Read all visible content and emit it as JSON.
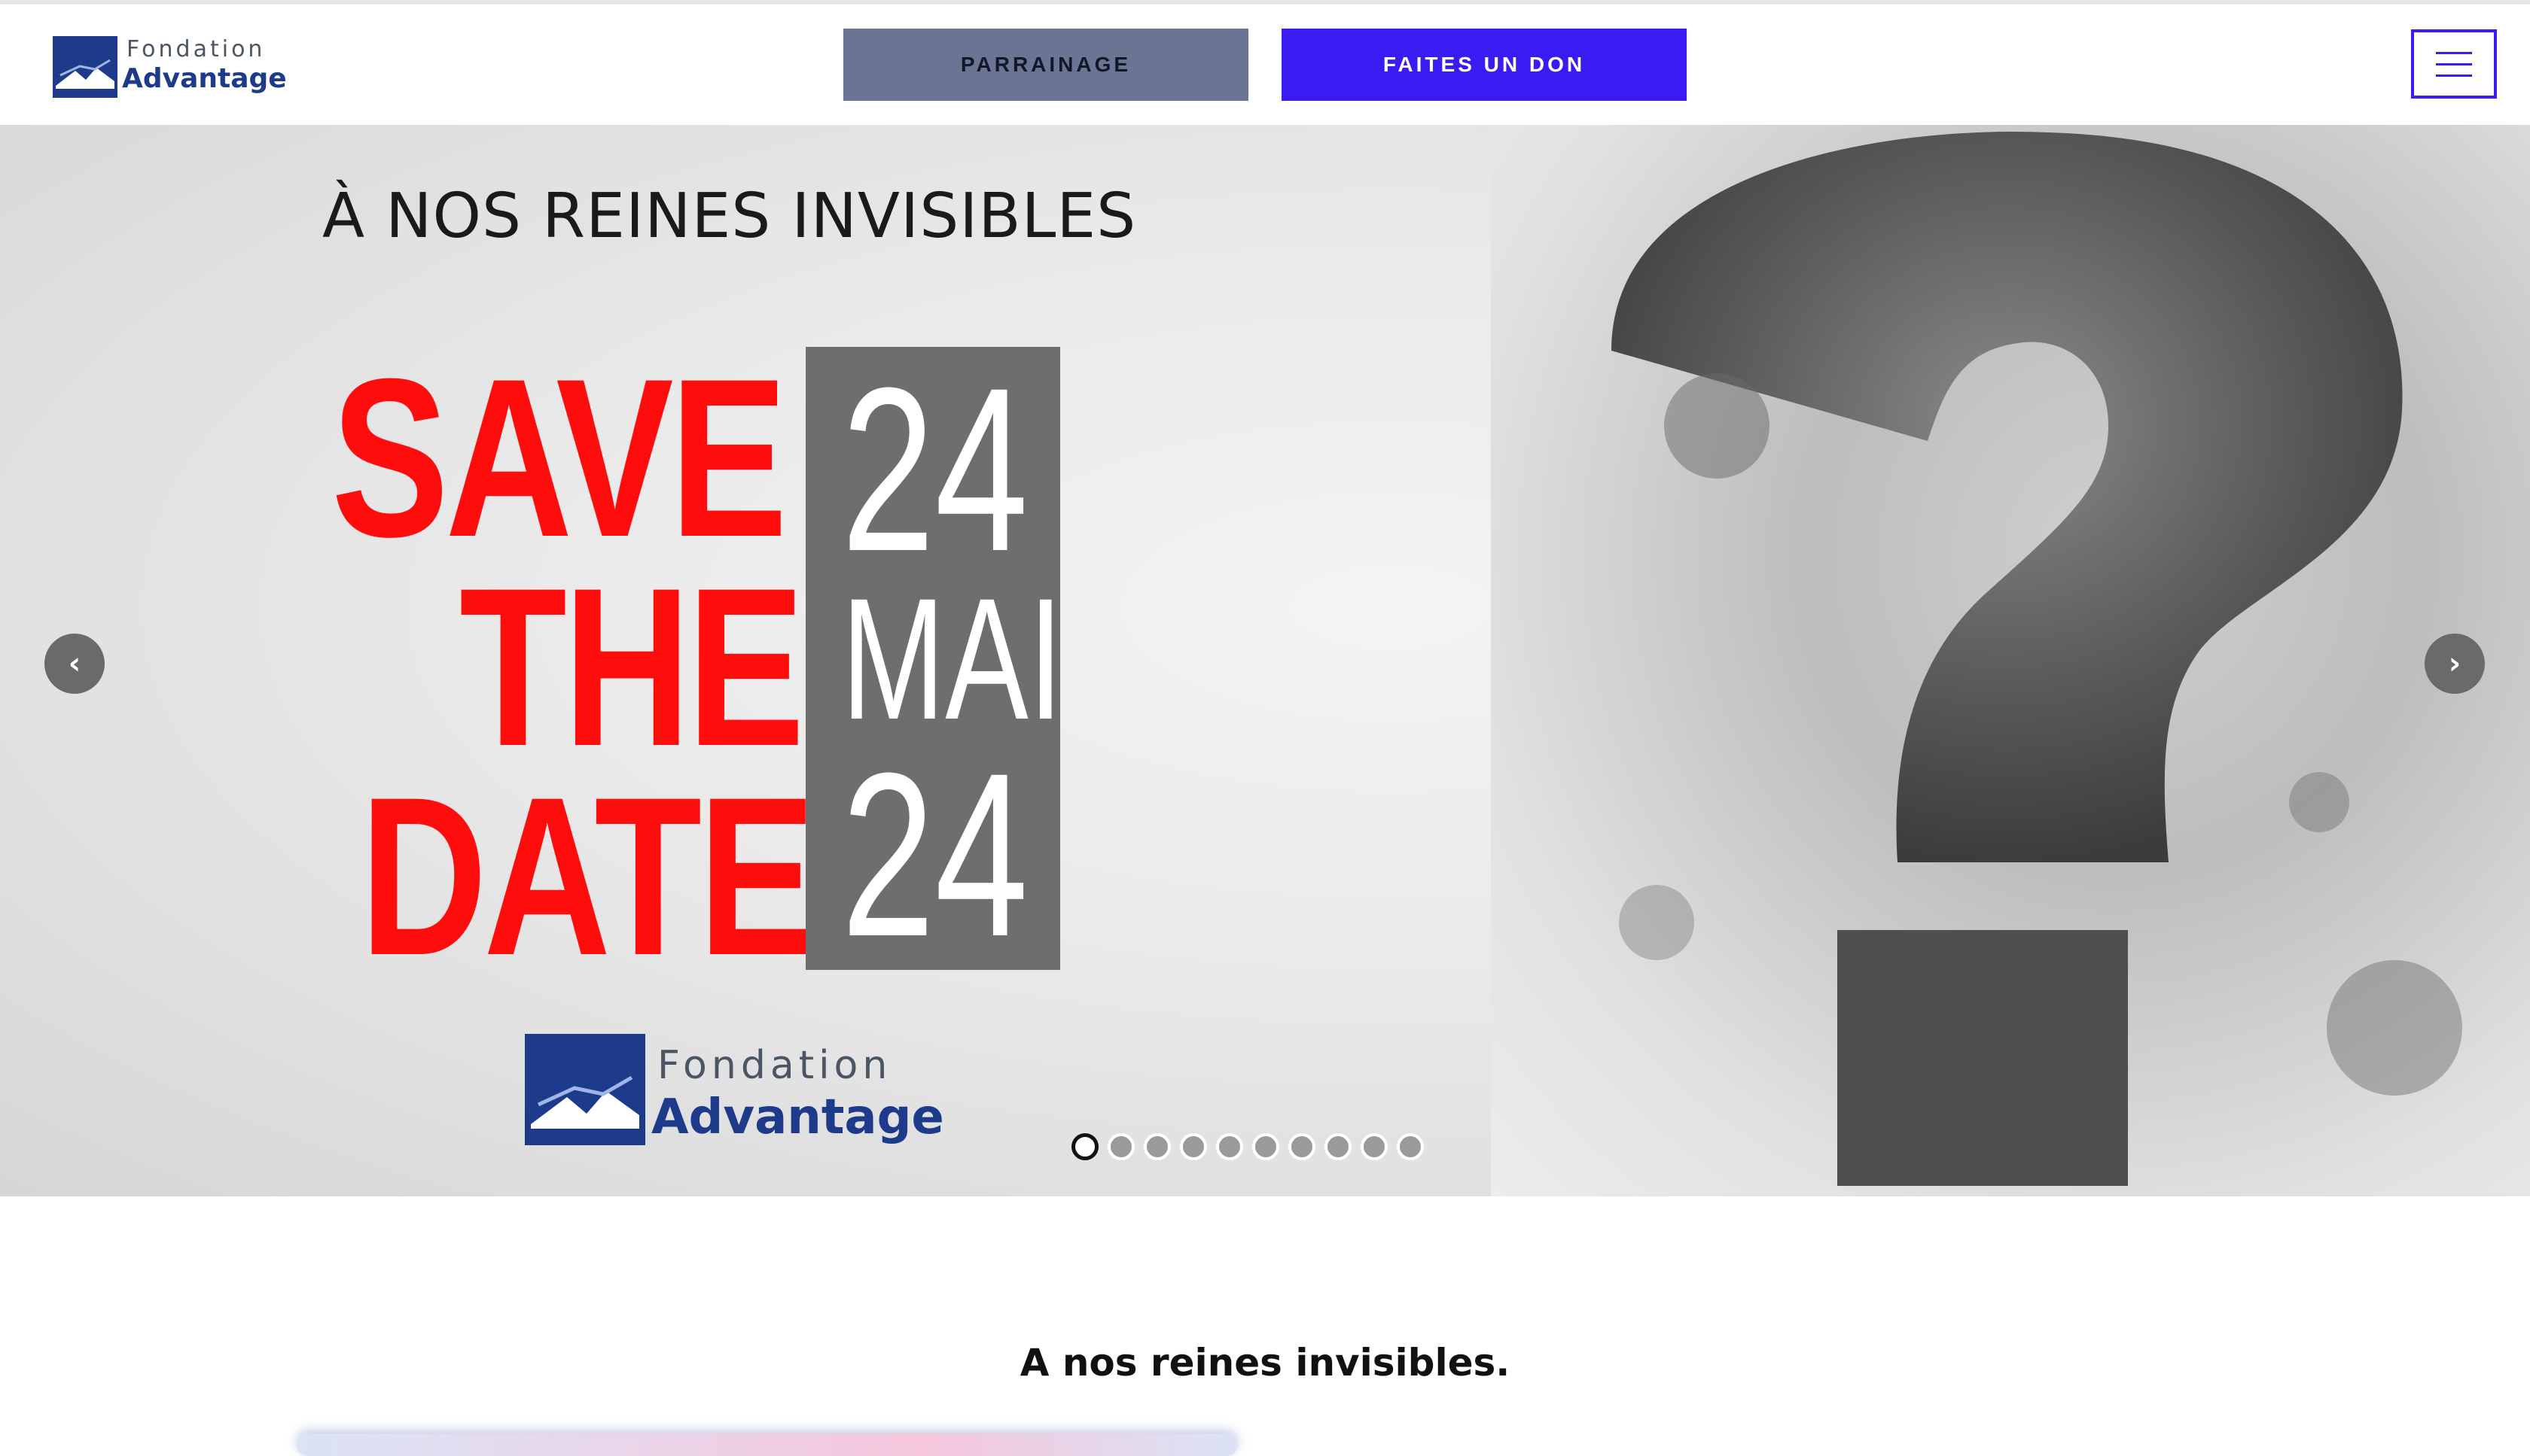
{
  "header": {
    "logo": {
      "line1": "Fondation",
      "line2": "Advantage"
    },
    "buttons": {
      "parrainage": "PARRAINAGE",
      "don": "FAITES UN DON"
    },
    "menu_icon": "hamburger-menu-icon"
  },
  "hero": {
    "subtitle": "À NOS REINES INVISIBLES",
    "save_lines": [
      "SAVE",
      "THE",
      "DATE"
    ],
    "date": {
      "day": "24",
      "month": "MAI",
      "year": "24"
    },
    "logo": {
      "line1": "Fondation",
      "line2": "Advantage"
    },
    "arrows": {
      "prev": "‹",
      "next": "›"
    },
    "slides_count": 10,
    "active_slide": 1,
    "colors": {
      "save_text": "#ff0d0d",
      "date_box": "#6e6e6e",
      "brand_blue": "#1e3a8a",
      "accent": "#3a1cf2"
    }
  },
  "section": {
    "title": "A nos reines invisibles."
  }
}
